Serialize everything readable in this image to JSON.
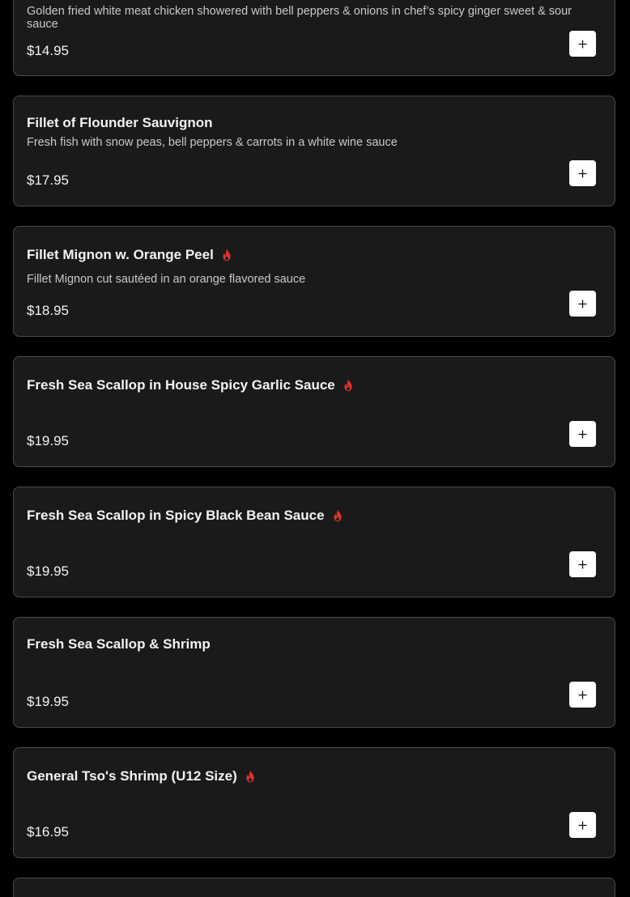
{
  "colors": {
    "page_background": "#000000",
    "card_background": "#1b1a1b",
    "card_border": "#4a4a4a",
    "spicy_icon": "#e0312b",
    "add_button": "#ffffff"
  },
  "icons": {
    "spicy": "flame-icon",
    "add": "plus-icon"
  },
  "menu_items": [
    {
      "name": "",
      "description": "Golden fried white meat chicken showered with bell peppers & onions in chef’s spicy ginger sweet & sour sauce",
      "price": "$14.95",
      "spicy": false
    },
    {
      "name": "Fillet of Flounder Sauvignon",
      "description": "Fresh fish with snow peas, bell peppers & carrots in a white wine sauce",
      "price": "$17.95",
      "spicy": false
    },
    {
      "name": "Fillet Mignon w. Orange Peel",
      "description": "Fillet Mignon cut sautéed in an orange flavored sauce",
      "price": "$18.95",
      "spicy": true
    },
    {
      "name": "Fresh Sea Scallop in House Spicy Garlic Sauce",
      "description": "",
      "price": "$19.95",
      "spicy": true
    },
    {
      "name": "Fresh Sea Scallop in Spicy Black Bean Sauce",
      "description": "",
      "price": "$19.95",
      "spicy": true
    },
    {
      "name": "Fresh Sea Scallop & Shrimp",
      "description": "",
      "price": "$19.95",
      "spicy": false
    },
    {
      "name": "General Tso's Shrimp (U12 Size)",
      "description": "",
      "price": "$16.95",
      "spicy": true
    }
  ]
}
